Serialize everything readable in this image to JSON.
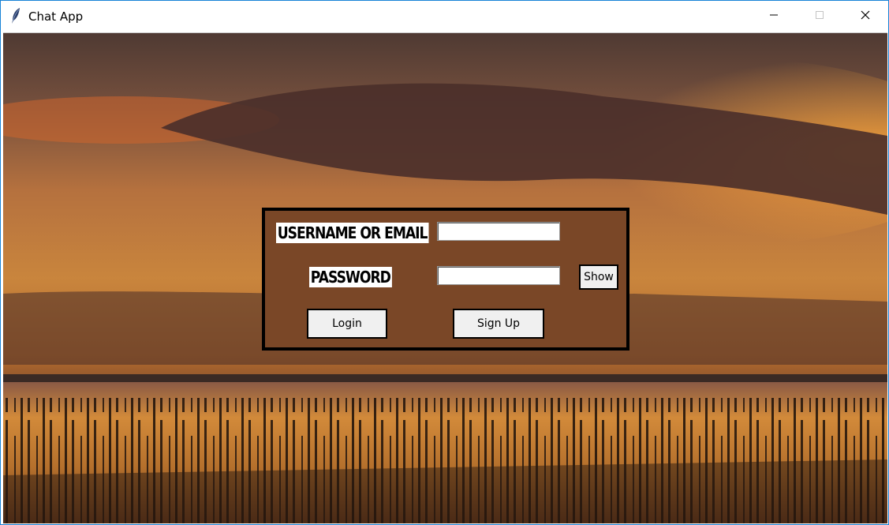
{
  "window": {
    "title": "Chat App",
    "icon": "feather-icon",
    "controls": [
      "minimize-icon",
      "maximize-icon",
      "close-icon"
    ]
  },
  "login": {
    "username_label": "USERNAME OR EMAIL",
    "username_value": "",
    "password_label": "PASSWORD",
    "password_value": "",
    "show_button": "Show",
    "login_button": "Login",
    "signup_button": "Sign Up"
  },
  "colors": {
    "panel": "#7a4727",
    "panel_border": "#000000",
    "button_face": "#f0f0f0",
    "window_border": "#1883d7"
  }
}
